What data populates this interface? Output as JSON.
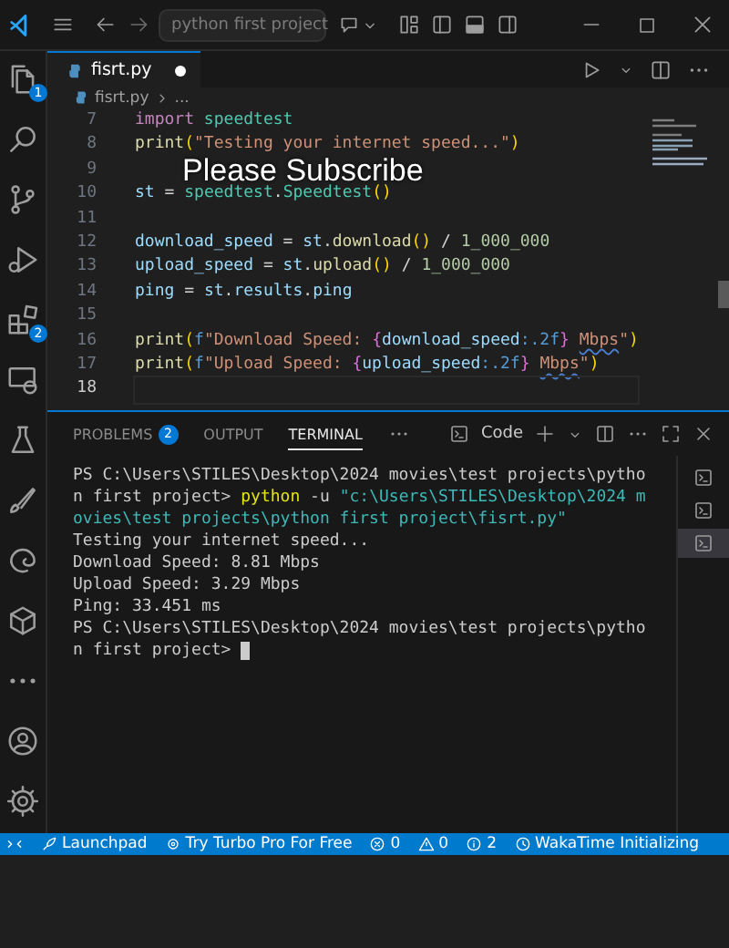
{
  "title_bar": {
    "search": "python first project"
  },
  "activity_bar": [
    {
      "kind": "explorer",
      "badge": "1"
    },
    {
      "kind": "search"
    },
    {
      "kind": "scm"
    },
    {
      "kind": "run"
    },
    {
      "kind": "extensions",
      "badge": "2"
    },
    {
      "kind": "remote"
    },
    {
      "kind": "testing"
    },
    {
      "kind": "brush"
    },
    {
      "kind": "edge"
    },
    {
      "kind": "cube"
    },
    {
      "kind": "more"
    },
    {
      "kind": "account"
    },
    {
      "kind": "settings"
    }
  ],
  "tabs": [
    {
      "label": "fisrt.py",
      "selected": true,
      "modified": true
    }
  ],
  "breadcrumb": [
    "fisrt.py",
    "..."
  ],
  "editor": {
    "lines": [
      {
        "number": "7",
        "active": false,
        "tokens": [
          {
            "kind": "keyword",
            "text": "import"
          },
          {
            "kind": "class",
            "text": " speedtest"
          }
        ]
      },
      {
        "number": "8",
        "active": false,
        "tokens": [
          {
            "kind": "function",
            "text": "print"
          },
          {
            "kind": "bracket",
            "text": "("
          },
          {
            "kind": "string",
            "text": "\"Testing your internet speed...\""
          },
          {
            "kind": "bracket",
            "text": ")"
          }
        ]
      },
      {
        "number": "9",
        "active": false
      },
      {
        "number": "10",
        "active": false,
        "tokens": [
          {
            "kind": "variable",
            "text": "st"
          },
          {
            "kind": "plain",
            "text": " = "
          },
          {
            "kind": "class",
            "text": "speedtest"
          },
          {
            "kind": "plain",
            "text": "."
          },
          {
            "kind": "class",
            "text": "Speedtest"
          },
          {
            "kind": "bracket",
            "text": "()"
          }
        ]
      },
      {
        "number": "11",
        "active": false
      },
      {
        "number": "12",
        "active": false,
        "tokens": [
          {
            "kind": "variable",
            "text": "download_speed"
          },
          {
            "kind": "plain",
            "text": " = "
          },
          {
            "kind": "variable",
            "text": "st"
          },
          {
            "kind": "plain",
            "text": "."
          },
          {
            "kind": "function",
            "text": "download"
          },
          {
            "kind": "bracket",
            "text": "()"
          },
          {
            "kind": "plain",
            "text": " / "
          },
          {
            "kind": "number",
            "text": "1_000_000"
          }
        ]
      },
      {
        "number": "13",
        "active": false,
        "tokens": [
          {
            "kind": "variable",
            "text": "upload_speed"
          },
          {
            "kind": "plain",
            "text": " = "
          },
          {
            "kind": "variable",
            "text": "st"
          },
          {
            "kind": "plain",
            "text": "."
          },
          {
            "kind": "function",
            "text": "upload"
          },
          {
            "kind": "bracket",
            "text": "()"
          },
          {
            "kind": "plain",
            "text": " / "
          },
          {
            "kind": "number",
            "text": "1_000_000"
          }
        ]
      },
      {
        "number": "14",
        "active": false,
        "tokens": [
          {
            "kind": "variable",
            "text": "ping"
          },
          {
            "kind": "plain",
            "text": " = "
          },
          {
            "kind": "variable",
            "text": "st"
          },
          {
            "kind": "plain",
            "text": "."
          },
          {
            "kind": "variable",
            "text": "results"
          },
          {
            "kind": "plain",
            "text": "."
          },
          {
            "kind": "variable",
            "text": "ping"
          }
        ]
      },
      {
        "number": "15",
        "active": false
      },
      {
        "number": "16",
        "active": false,
        "tokens": [
          {
            "kind": "function",
            "text": "print"
          },
          {
            "kind": "bracket",
            "text": "("
          },
          {
            "kind": "prefix",
            "text": "f"
          },
          {
            "kind": "string",
            "text": "\"Download Speed: "
          },
          {
            "kind": "brace",
            "text": "{"
          },
          {
            "kind": "variable",
            "text": "download_speed"
          },
          {
            "kind": "prefix",
            "text": ":.2f"
          },
          {
            "kind": "brace",
            "text": "} "
          },
          {
            "kind": "misspelled",
            "text": "Mbps"
          },
          {
            "kind": "string",
            "text": "\""
          },
          {
            "kind": "bracket",
            "text": ")"
          }
        ]
      },
      {
        "number": "17",
        "active": false,
        "tokens": [
          {
            "kind": "function",
            "text": "print"
          },
          {
            "kind": "bracket",
            "text": "("
          },
          {
            "kind": "prefix",
            "text": "f"
          },
          {
            "kind": "string",
            "text": "\"Upload Speed: "
          },
          {
            "kind": "brace",
            "text": "{"
          },
          {
            "kind": "variable",
            "text": "upload_speed"
          },
          {
            "kind": "prefix",
            "text": ":.2f"
          },
          {
            "kind": "brace",
            "text": "} "
          },
          {
            "kind": "misspelled",
            "text": "Mbps"
          },
          {
            "kind": "string",
            "text": "\""
          },
          {
            "kind": "bracket",
            "text": ")"
          }
        ]
      },
      {
        "number": "18",
        "active": true
      }
    ]
  },
  "overlay_caption": "Please Subscribe",
  "panel": {
    "tabs": [
      {
        "label": "PROBLEMS",
        "badge": "2",
        "selected": false
      },
      {
        "label": "OUTPUT",
        "selected": false
      },
      {
        "label": "TERMINAL",
        "selected": true
      }
    ],
    "terminal_name": "Code",
    "terminal_lines": [
      [
        {
          "kind": "plain",
          "text": "PS C:\\Users\\STILES\\Desktop\\2024 movies\\test projects\\pytho"
        }
      ],
      [
        {
          "kind": "plain",
          "text": "n first project> "
        },
        {
          "kind": "command",
          "text": "python"
        },
        {
          "kind": "plain",
          "text": " -u "
        },
        {
          "kind": "path",
          "text": "\"c:\\Users\\STILES\\Desktop\\2024 m"
        }
      ],
      [
        {
          "kind": "path",
          "text": "ovies\\test projects\\python first project\\fisrt.py\""
        }
      ],
      [
        {
          "kind": "plain",
          "text": "Testing your internet speed..."
        }
      ],
      [
        {
          "kind": "plain",
          "text": "Download Speed: 8.81 Mbps"
        }
      ],
      [
        {
          "kind": "plain",
          "text": "Upload Speed: 3.29 Mbps"
        }
      ],
      [
        {
          "kind": "plain",
          "text": "Ping: 33.451 ms"
        }
      ],
      [
        {
          "kind": "plain",
          "text": "PS C:\\Users\\STILES\\Desktop\\2024 movies\\test projects\\pytho"
        }
      ],
      [
        {
          "kind": "plain",
          "text": "n first project> "
        }
      ]
    ],
    "terminals": [
      {
        "selected": false
      },
      {
        "selected": false
      },
      {
        "selected": true
      }
    ]
  },
  "status_bar": [
    {
      "kind": "remote"
    },
    {
      "kind": "launchpad",
      "label": "Launchpad"
    },
    {
      "kind": "turbo",
      "label": "Try Turbo Pro For Free"
    },
    {
      "kind": "errors",
      "label": "0"
    },
    {
      "kind": "warnings",
      "label": "0"
    },
    {
      "kind": "info",
      "label": "2"
    },
    {
      "kind": "wakatime",
      "label": "WakaTime Initializing"
    }
  ]
}
